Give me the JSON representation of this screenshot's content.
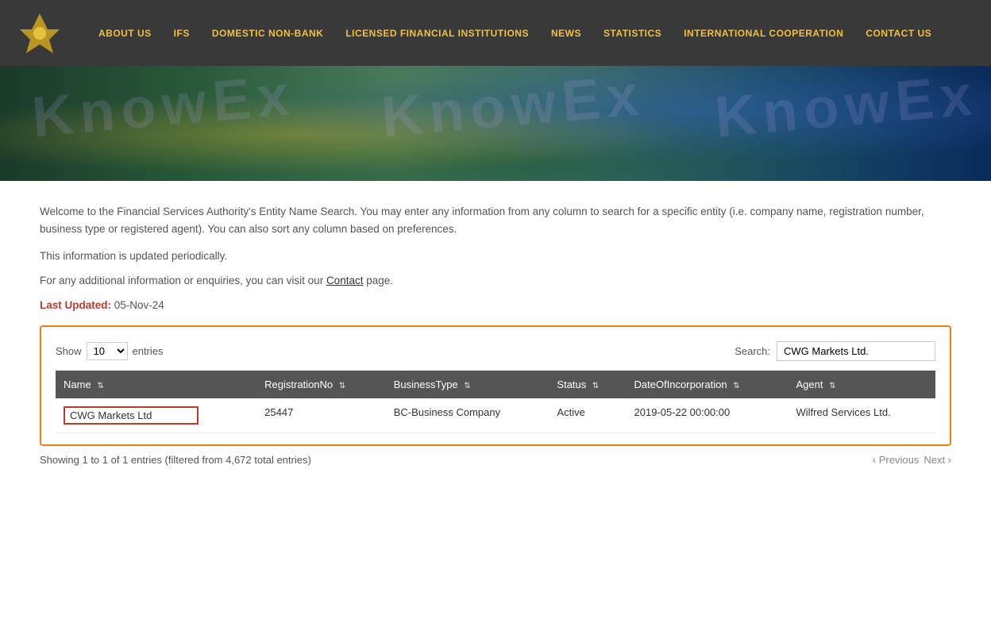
{
  "nav": {
    "links": [
      {
        "id": "about-us",
        "label": "ABOUT US"
      },
      {
        "id": "ifs",
        "label": "IFS"
      },
      {
        "id": "domestic-non-bank",
        "label": "DOMESTIC NON-BANK"
      },
      {
        "id": "licensed-financial-institutions",
        "label": "LICENSED FINANCIAL INSTITUTIONS"
      },
      {
        "id": "news",
        "label": "NEWS"
      },
      {
        "id": "statistics",
        "label": "STATISTICS"
      },
      {
        "id": "international-cooperation",
        "label": "INTERNATIONAL COOPERATION"
      },
      {
        "id": "contact-us",
        "label": "CONTACT US"
      }
    ]
  },
  "hero": {
    "watermarks": [
      "KnowEx",
      "KnowEx",
      "KnowEx"
    ]
  },
  "content": {
    "intro": "Welcome to the Financial Services Authority's Entity Name Search. You may enter any information from any column to search for a specific entity (i.e. company name, registration number, business type or registered agent). You can also sort any column based on preferences.",
    "info": "This information is updated periodically.",
    "contact_line_before": "For any additional information or enquiries, you can visit our ",
    "contact_link_text": "Contact",
    "contact_line_after": " page.",
    "last_updated_label": "Last Updated:",
    "last_updated_value": "05-Nov-24"
  },
  "table_controls": {
    "show_label": "Show",
    "entries_label": "entries",
    "show_value": "10",
    "search_label": "Search:",
    "search_value": "CWG Markets Ltd."
  },
  "table": {
    "columns": [
      {
        "id": "name",
        "label": "Name",
        "sortable": true
      },
      {
        "id": "registration_no",
        "label": "RegistrationNo",
        "sortable": true
      },
      {
        "id": "business_type",
        "label": "BusinessType",
        "sortable": true
      },
      {
        "id": "status",
        "label": "Status",
        "sortable": true
      },
      {
        "id": "date_of_incorporation",
        "label": "DateOfIncorporation",
        "sortable": true
      },
      {
        "id": "agent",
        "label": "Agent",
        "sortable": true
      }
    ],
    "rows": [
      {
        "name": "CWG Markets Ltd",
        "registration_no": "25447",
        "business_type": "BC-Business Company",
        "status": "Active",
        "date_of_incorporation": "2019-05-22 00:00:00",
        "agent": "Wilfred Services Ltd."
      }
    ]
  },
  "pagination": {
    "showing_text": "Showing 1 to 1 of 1 entries (filtered from 4,672 total entries)",
    "previous_label": "‹ Previous",
    "next_label": "Next ›"
  }
}
